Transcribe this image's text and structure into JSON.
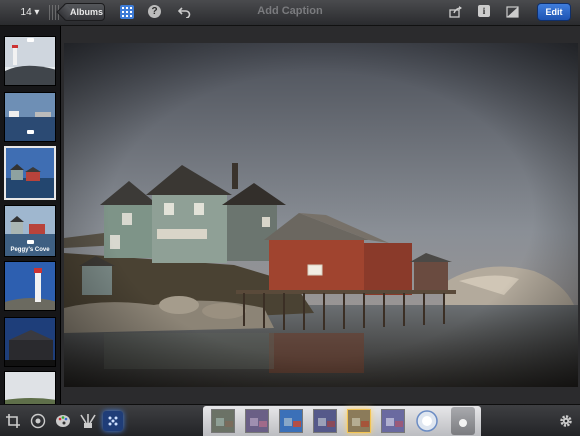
{
  "toolbar": {
    "photo_count": "14 ▾",
    "albums_label": "Albums",
    "caption_placeholder": "Add Caption",
    "help_glyph": "?",
    "info_glyph": "i",
    "edit_label": "Edit",
    "icons": [
      "grid-icon",
      "help-icon",
      "undo-icon",
      "share-icon",
      "info-icon",
      "compare-icon"
    ]
  },
  "filmstrip": {
    "items": [
      {
        "name": "lighthouse-snow"
      },
      {
        "name": "boats-harbor"
      },
      {
        "name": "peggys-cove-houses",
        "selected": true
      },
      {
        "name": "peggys-cove-label",
        "label": "Peggy's Cove"
      },
      {
        "name": "lighthouse-blue-sky"
      },
      {
        "name": "building-dusk"
      },
      {
        "name": "clouds-landscape"
      }
    ]
  },
  "bottom_toolbar": {
    "tools": [
      "crop-icon",
      "aperture-icon",
      "palette-icon",
      "brushes-icon",
      "effects-icon"
    ],
    "active_tool": "effects-icon",
    "presets": 6,
    "active_preset": 5
  },
  "colors": {
    "accent": "#3d7bd6",
    "edit_button": "#2b63c4",
    "toolbar": "#3a3b3e",
    "background": "#1b1b1d"
  }
}
